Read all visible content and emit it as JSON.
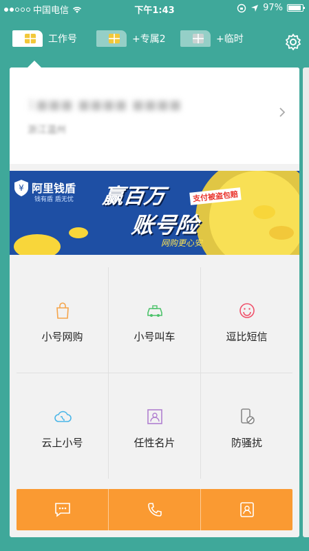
{
  "status_bar": {
    "carrier": "中国电信",
    "time": "下午1:43",
    "battery": "97%"
  },
  "sim_tabs": [
    {
      "label": "工作号"
    },
    {
      "label": "+专属2"
    },
    {
      "label": "+临时"
    }
  ],
  "account": {
    "number": "1■■■ ■■■■ ■■■■",
    "location": "浙江温州"
  },
  "banner": {
    "brand": "阿里钱盾",
    "brand_sub": "钱有盾 盾无忧",
    "headline_1": "赢百万",
    "headline_2": "账号险",
    "tag": "支付被盗包赔",
    "tagline": "网购更心安"
  },
  "features": [
    {
      "label": "小号网购",
      "icon": "shopping-bag-icon",
      "color": "#f5a44a"
    },
    {
      "label": "小号叫车",
      "icon": "car-icon",
      "color": "#4cc26a"
    },
    {
      "label": "逗比短信",
      "icon": "smiley-icon",
      "color": "#f0506a"
    },
    {
      "label": "云上小号",
      "icon": "cloud-phone-icon",
      "color": "#4ab6e8"
    },
    {
      "label": "任性名片",
      "icon": "contact-card-icon",
      "color": "#b07fd0"
    },
    {
      "label": "防骚扰",
      "icon": "block-phone-icon",
      "color": "#888888"
    }
  ],
  "bottom_bar": [
    {
      "icon": "message-icon"
    },
    {
      "icon": "phone-icon"
    },
    {
      "icon": "contacts-icon"
    }
  ],
  "colors": {
    "background": "#3fa89a",
    "accent_orange": "#fa9a32",
    "banner_blue": "#1e4fa4"
  }
}
